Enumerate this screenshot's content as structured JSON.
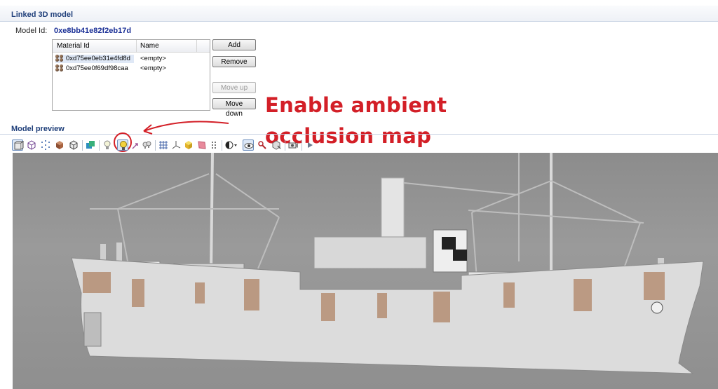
{
  "linked_model": {
    "title": "Linked 3D model",
    "model_id_label": "Model Id:",
    "model_id_value": "0xe8bb41e82f2eb17d"
  },
  "materials_table": {
    "columns": [
      "Material Id",
      "Name"
    ],
    "rows": [
      {
        "material_id": "0xd75ee0eb31e4fd8d",
        "name": "<empty>"
      },
      {
        "material_id": "0xd75ee0f69df98caa",
        "name": "<empty>"
      }
    ]
  },
  "buttons": {
    "add": "Add",
    "remove": "Remove",
    "move_up": "Move up",
    "move_down": "Move down"
  },
  "annotation": {
    "line1": "Enable ambient",
    "line2": "occlusion map",
    "color": "#d31f27"
  },
  "model_preview": {
    "title": "Model preview",
    "toolbar_icons": [
      "solid-view-icon",
      "wireframe-cube-icon",
      "points-view-icon",
      "shaded-cube-icon",
      "textured-cube-icon",
      "uv-map-icon",
      "light-bulb-icon",
      "ambient-occlusion-icon",
      "normal-arrow-icon",
      "lights-icon",
      "grid-icon",
      "axes-icon",
      "bounding-box-icon",
      "pink-flag-icon",
      "dotted-grid-icon",
      "background-color-icon",
      "eye-icon",
      "skeleton-icon",
      "reset-view-icon",
      "camera-icon",
      "play-icon"
    ]
  },
  "colors": {
    "header_text": "#1f3f7a",
    "id_text": "#1a2f96",
    "viewport_bg": "#939393"
  }
}
